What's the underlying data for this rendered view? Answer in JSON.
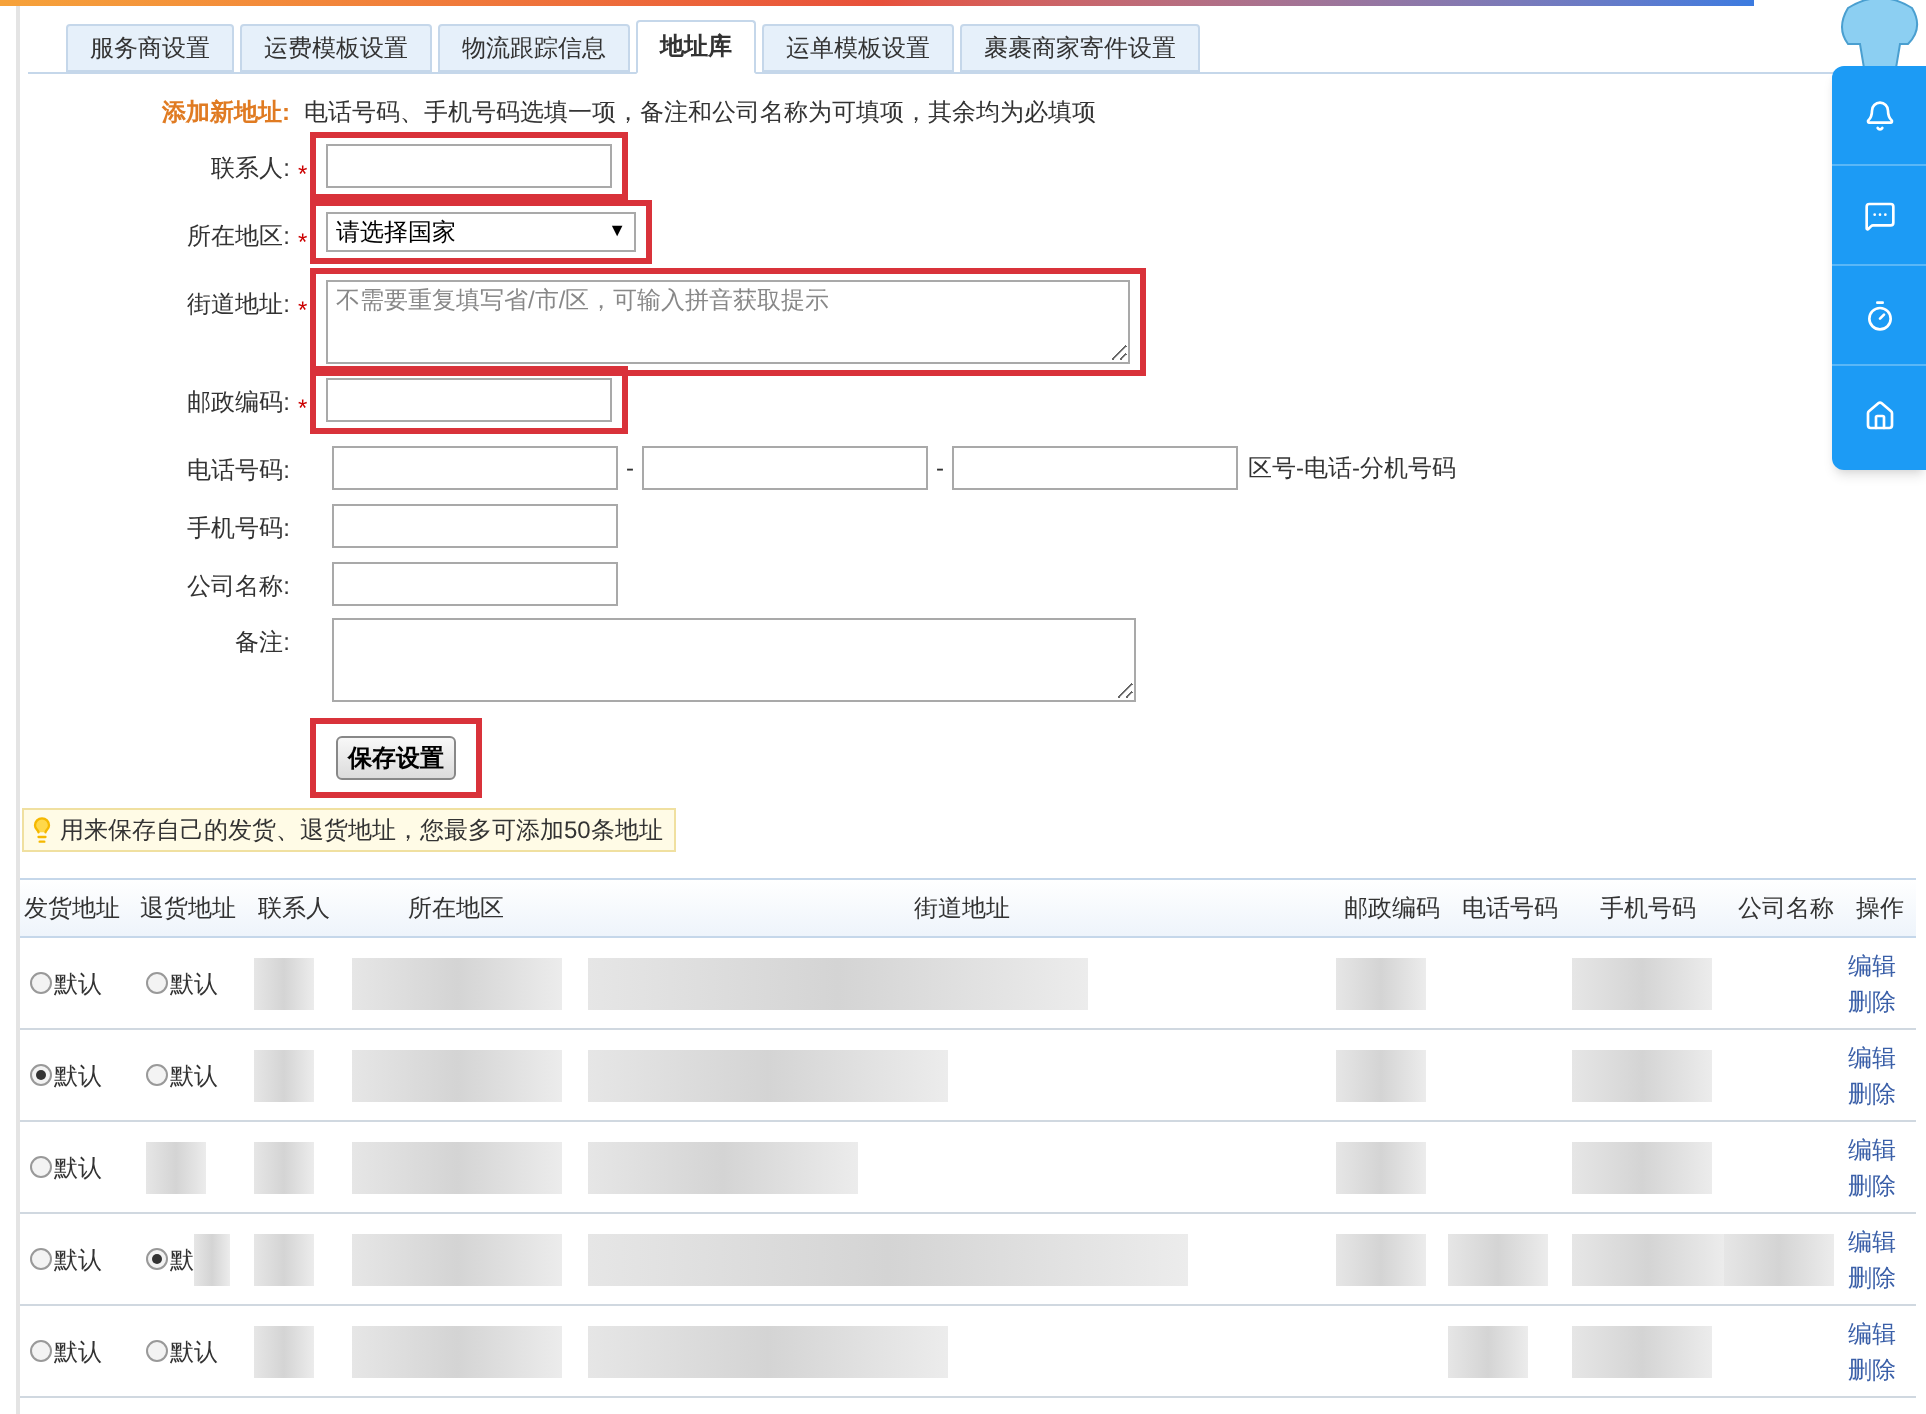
{
  "tabs": [
    {
      "label": "服务商设置",
      "selected": false
    },
    {
      "label": "运费模板设置",
      "selected": false
    },
    {
      "label": "物流跟踪信息",
      "selected": false
    },
    {
      "label": "地址库",
      "selected": true
    },
    {
      "label": "运单模板设置",
      "selected": false
    },
    {
      "label": "裹裹商家寄件设置",
      "selected": false
    }
  ],
  "form": {
    "title": "添加新地址:",
    "note": "电话号码、手机号码选填一项，备注和公司名称为可填项，其余均为必填项",
    "fields": [
      {
        "kind": "text",
        "label": "联系人:",
        "required_mark": "*",
        "highlighted": true
      },
      {
        "kind": "select",
        "label": "所在地区:",
        "required_mark": "*",
        "highlighted": true,
        "value": "请选择国家",
        "arrow": "▼"
      },
      {
        "kind": "textarea",
        "label": "街道地址:",
        "required_mark": "*",
        "highlighted": true,
        "placeholder": "不需要重复填写省/市/区，可输入拼音获取提示"
      },
      {
        "kind": "text",
        "label": "邮政编码:",
        "required_mark": "*",
        "highlighted": true
      },
      {
        "kind": "phone",
        "label": "电话号码:",
        "highlighted": false,
        "separators": [
          "-",
          "-"
        ],
        "hint": "区号-电话-分机号码"
      },
      {
        "kind": "text",
        "label": "手机号码:",
        "highlighted": false
      },
      {
        "kind": "text",
        "label": "公司名称:",
        "highlighted": false
      },
      {
        "kind": "textarea",
        "label": "备注:",
        "highlighted": false
      }
    ],
    "save_button": {
      "label": "保存设置",
      "highlighted": true
    }
  },
  "tip": "用来保存自己的发货、退货地址，您最多可添加50条地址",
  "table": {
    "columns": [
      "发货地址",
      "退货地址",
      "联系人",
      "所在地区",
      "街道地址",
      "邮政编码",
      "电话号码",
      "手机号码",
      "公司名称",
      "操作"
    ],
    "rows": [
      {
        "ship_default": {
          "label": "默认",
          "selected": false
        },
        "return_default": {
          "label": "默认",
          "selected": false
        },
        "actions": [
          "编辑",
          "删除"
        ]
      },
      {
        "ship_default": {
          "label": "默认",
          "selected": true
        },
        "return_default": {
          "label": "默认",
          "selected": false
        },
        "actions": [
          "编辑",
          "删除"
        ]
      },
      {
        "ship_default": {
          "label": "默认",
          "selected": false
        },
        "actions": [
          "编辑",
          "删除"
        ]
      },
      {
        "ship_default": {
          "label": "默认",
          "selected": false
        },
        "return_default": {
          "label": "默",
          "selected": true
        },
        "actions": [
          "编辑",
          "删除"
        ]
      },
      {
        "ship_default": {
          "label": "默认",
          "selected": false
        },
        "return_default": {
          "label": "默认",
          "selected": false
        },
        "actions": [
          "编辑",
          "删除"
        ]
      }
    ]
  }
}
